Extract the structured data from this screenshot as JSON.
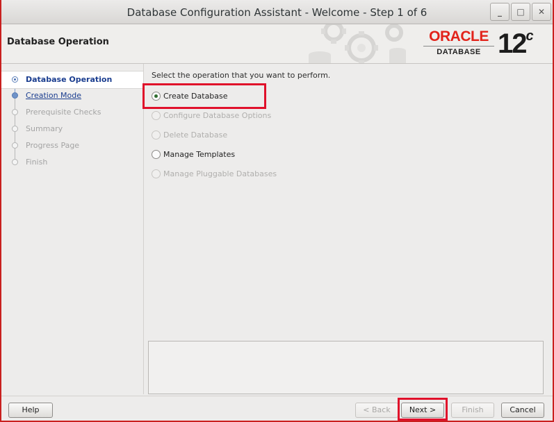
{
  "window": {
    "title": "Database Configuration Assistant - Welcome - Step 1 of 6",
    "controls": {
      "minimize": "_",
      "maximize": "□",
      "close": "✕"
    }
  },
  "header": {
    "page_title": "Database Operation",
    "brand_name": "ORACLE",
    "brand_product": "DATABASE",
    "version": "12",
    "version_suffix": "c"
  },
  "nav": {
    "items": [
      {
        "label": "Database Operation",
        "state": "current"
      },
      {
        "label": "Creation Mode",
        "state": "link"
      },
      {
        "label": "Prerequisite Checks",
        "state": "disabled"
      },
      {
        "label": "Summary",
        "state": "disabled"
      },
      {
        "label": "Progress Page",
        "state": "disabled"
      },
      {
        "label": "Finish",
        "state": "disabled"
      }
    ]
  },
  "main": {
    "prompt": "Select the operation that you want to perform.",
    "options": [
      {
        "label": "Create Database",
        "checked": true,
        "enabled": true,
        "highlighted": true
      },
      {
        "label": "Configure Database Options",
        "checked": false,
        "enabled": false
      },
      {
        "label": "Delete Database",
        "checked": false,
        "enabled": false
      },
      {
        "label": "Manage Templates",
        "checked": false,
        "enabled": true
      },
      {
        "label": "Manage Pluggable Databases",
        "checked": false,
        "enabled": false
      }
    ]
  },
  "buttons": {
    "help": "Help",
    "back": "< Back",
    "next": "Next >",
    "finish": "Finish",
    "cancel": "Cancel"
  },
  "colors": {
    "highlight": "#e0102a",
    "brand_red": "#e2231a",
    "link_blue": "#1a3d8f",
    "desktop": "#c9201f"
  }
}
